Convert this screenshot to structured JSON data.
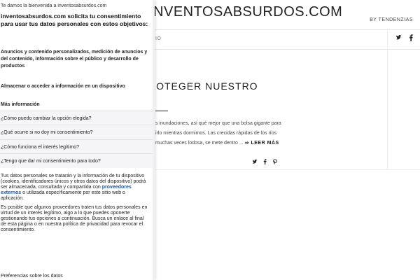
{
  "site": {
    "title": "INVENTOSABSURDOS.COM",
    "byline": "BY TENDENZIAS",
    "nav_fragment": "IO",
    "social_top": [
      "twitter-icon",
      "facebook-icon"
    ]
  },
  "post": {
    "title": "ROTEGER NUESTRO",
    "excerpt_lines": [
      "s inundaciones, así qué mejor que una bolsa gigante para",
      "irlo mientras dormimos. Las crecidas rápidas de los ríos",
      "muchas veces lodosa, se mete dentro ..."
    ],
    "read_more": "⇒ LEER MÁS",
    "share_icons": [
      "twitter-icon",
      "facebook-icon",
      "pinterest-icon"
    ]
  },
  "consent": {
    "welcome": "Te damos la bienvenida a inventosabsurdos.com",
    "title": "inventosabsurdos.com solicita tu consentimiento para usar tus datos personales con estos objetivos:",
    "purposes": [
      "Anuncios y contenido personalizados, medición de anuncios y del contenido, información sobre el público y desarrollo de productos",
      "Almacenar o acceder a información en un dispositivo"
    ],
    "more_info": "Más información",
    "faqs": [
      "¿Cómo puedo cambiar la opción elegida?",
      "¿Qué ocurre si no doy mi consentimiento?",
      "¿Cómo funciona el interés legítimo?",
      "¿Tengo que dar mi consentimiento para todo?"
    ],
    "body1_before": "Tus datos personales se tratarán y la información de tu dispositivo (cookies, identificadores únicos y otros datos del dispositivo) podrá ser almacenada, consultada y compartida con ",
    "body1_link": "proveedores externos",
    "body1_after": " o utilizada específicamente por este sitio web o aplicación.",
    "body2": "Es posible que algunos proveedores traten tus datos personales en virtud de un interés legítimo, algo a lo que puedes oponerte gestionando tus opciones a continuación. Busca un enlace al final de esta página o en nuestra política de privacidad para revocar el consentimiento.",
    "preferences_title": "Preferencias sobre los datos"
  }
}
